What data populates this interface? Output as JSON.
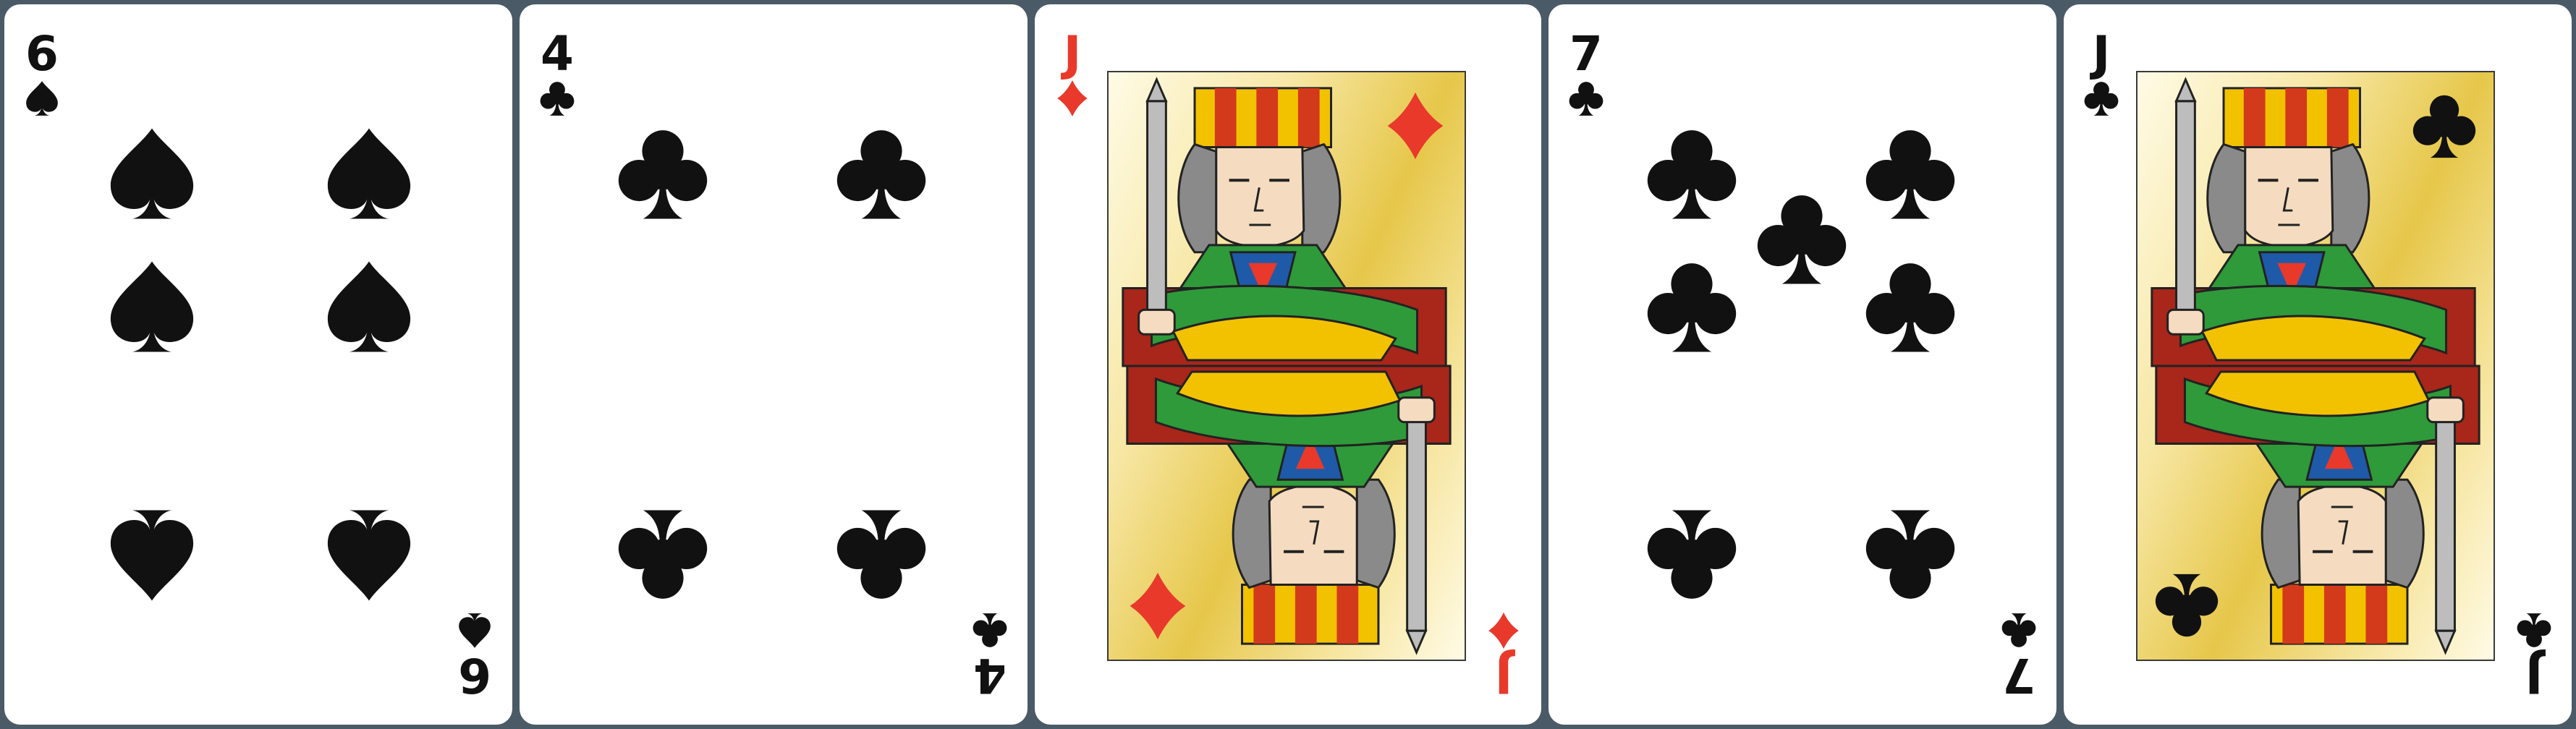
{
  "colors": {
    "background": "#4a5a66",
    "card": "#ffffff",
    "black_suit": "#111111",
    "red_suit": "#e8392b",
    "face_gold": "#e6c74a"
  },
  "cards": [
    {
      "rank": "6",
      "suit": "spades",
      "suit_icon": "spade-icon",
      "color": "black"
    },
    {
      "rank": "4",
      "suit": "clubs",
      "suit_icon": "club-icon",
      "color": "black"
    },
    {
      "rank": "J",
      "suit": "diamonds",
      "suit_icon": "diamond-icon",
      "color": "red"
    },
    {
      "rank": "7",
      "suit": "clubs",
      "suit_icon": "club-icon",
      "color": "black"
    },
    {
      "rank": "J",
      "suit": "clubs",
      "suit_icon": "club-icon",
      "color": "black"
    }
  ]
}
